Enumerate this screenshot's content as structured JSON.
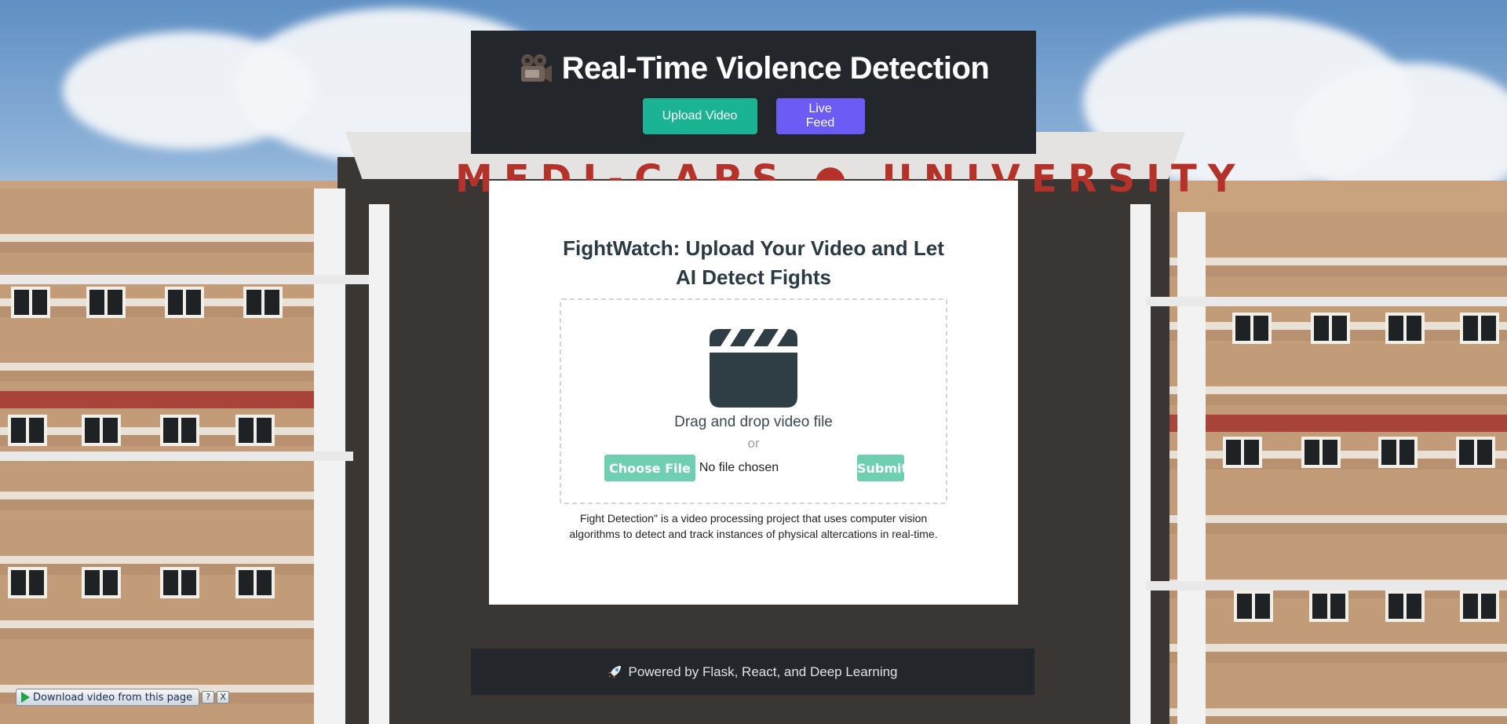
{
  "header": {
    "title": "Real-Time Violence Detection",
    "title_icon": "film-projector-icon",
    "nav": {
      "upload_label": "Upload Video",
      "live_label": "Live Feed"
    }
  },
  "upload_card": {
    "heading": "FightWatch: Upload Your Video and Let AI Detect Fights",
    "dropzone_icon": "clapperboard-icon",
    "drag_text": "Drag and drop video file",
    "or_text": "or",
    "choose_label": "Choose File",
    "file_status": "No file chosen",
    "submit_label": "Submit",
    "description": "Fight Detection\" is a video processing project that uses computer vision algorithms to detect and track instances of physical altercations in real-time."
  },
  "footer": {
    "icon": "rocket-icon",
    "text": "Powered by Flask, React, and Deep Learning"
  },
  "download_bar": {
    "label": "Download video from this page",
    "help_label": "?",
    "close_label": "X"
  },
  "colors": {
    "header_bg": "#23272b",
    "upload_btn": "#1ab394",
    "live_btn": "#6c5cf5",
    "file_btns": "#6fcfb2",
    "heading_text": "#2a3a44"
  }
}
